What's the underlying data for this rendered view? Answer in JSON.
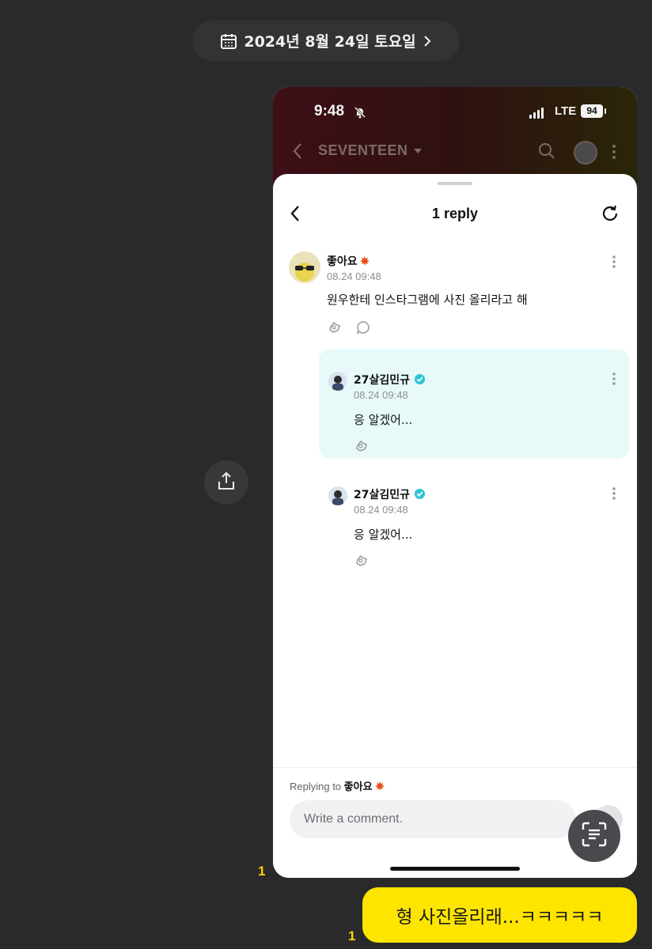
{
  "date_header": {
    "label": "2024년 8월 24일 토요일"
  },
  "phone": {
    "status": {
      "time": "9:48",
      "network": "LTE",
      "battery": "94"
    },
    "app": {
      "title": "SEVENTEEN"
    },
    "sheet": {
      "title": "1 reply",
      "comment": {
        "author": "좋아요",
        "date": "08.24 09:48",
        "text": "원우한테 인스타그램에 사진 올리라고 해"
      },
      "replies": [
        {
          "author": "27살김민규",
          "date": "08.24 09:48",
          "text": "응 알겠어..."
        },
        {
          "author": "27살김민규",
          "date": "08.24 09:48",
          "text": "응 알겠어..."
        }
      ],
      "replying_prefix": "Replying to",
      "replying_name": "좋아요",
      "input_placeholder": "Write a comment."
    }
  },
  "chat": {
    "unread_photo": "1",
    "unread_message": "1",
    "message": "형 사진올리래...ㅋㅋㅋㅋㅋ"
  },
  "colors": {
    "background": "#2a2a2c",
    "bubble": "#fee500",
    "unread": "#ffd400",
    "highlight_reply": "#e7faf9",
    "verified": "#2ec5d3"
  }
}
